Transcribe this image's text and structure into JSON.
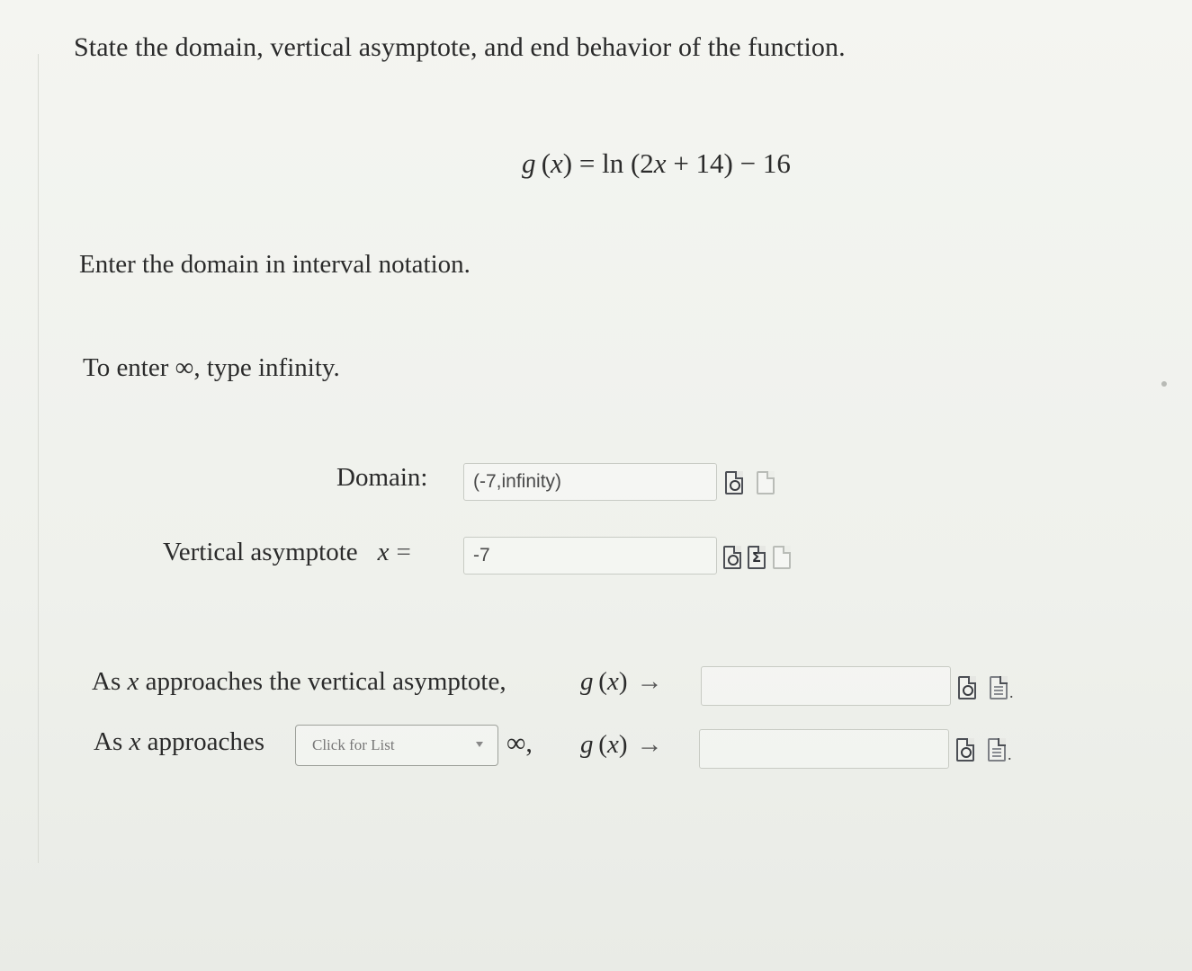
{
  "question": "State the domain, vertical asymptote, and end behavior of the function.",
  "equation": {
    "g": "g",
    "x": "x",
    "rhs": "= ln (2",
    "x2": "x",
    "tail": "+ 14) − 16"
  },
  "instructions": {
    "domain": "Enter the domain in interval notation.",
    "infinity": "To enter ∞, type infinity."
  },
  "domain": {
    "label": "Domain:",
    "value": "(-7,infinity)"
  },
  "vertical_asymptote": {
    "label": "Vertical asymptote",
    "var": "x",
    "eq": "=",
    "value": "-7"
  },
  "end_behavior": {
    "row1": {
      "prefix": "As ",
      "var": "x",
      "suffix": " approaches the vertical asymptote,",
      "g": "g",
      "gx_var": "x",
      "arrow": "→",
      "value": ""
    },
    "row2": {
      "prefix": "As ",
      "var": "x",
      "suffix": " approaches",
      "select_label": "Click for List",
      "inf": "∞,",
      "g": "g",
      "gx_var": "x",
      "arrow": "→",
      "value": ""
    }
  },
  "icons": {
    "preview": "preview-icon",
    "sigma": "sigma-icon",
    "blank": "document-icon",
    "sigma_glyph": "Σ"
  }
}
